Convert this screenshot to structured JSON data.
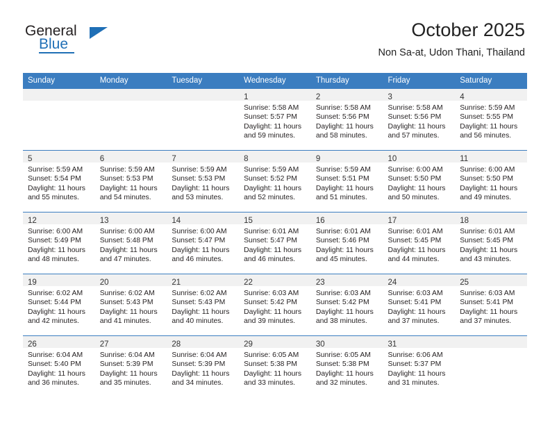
{
  "brand": {
    "name_top": "General",
    "name_bottom": "Blue",
    "accent_color": "#1f6fb6"
  },
  "header": {
    "title": "October 2025",
    "subtitle": "Non Sa-at, Udon Thani, Thailand"
  },
  "calendar": {
    "header_bg": "#3b7dc0",
    "header_text_color": "#ffffff",
    "daynum_band_bg": "#f1f1f1",
    "weekday_headers": [
      "Sunday",
      "Monday",
      "Tuesday",
      "Wednesday",
      "Thursday",
      "Friday",
      "Saturday"
    ],
    "weeks": [
      [
        {
          "empty": true
        },
        {
          "empty": true
        },
        {
          "empty": true
        },
        {
          "day": "1",
          "sunrise": "Sunrise: 5:58 AM",
          "sunset": "Sunset: 5:57 PM",
          "daylight_line1": "Daylight: 11 hours",
          "daylight_line2": "and 59 minutes."
        },
        {
          "day": "2",
          "sunrise": "Sunrise: 5:58 AM",
          "sunset": "Sunset: 5:56 PM",
          "daylight_line1": "Daylight: 11 hours",
          "daylight_line2": "and 58 minutes."
        },
        {
          "day": "3",
          "sunrise": "Sunrise: 5:58 AM",
          "sunset": "Sunset: 5:56 PM",
          "daylight_line1": "Daylight: 11 hours",
          "daylight_line2": "and 57 minutes."
        },
        {
          "day": "4",
          "sunrise": "Sunrise: 5:59 AM",
          "sunset": "Sunset: 5:55 PM",
          "daylight_line1": "Daylight: 11 hours",
          "daylight_line2": "and 56 minutes."
        }
      ],
      [
        {
          "day": "5",
          "sunrise": "Sunrise: 5:59 AM",
          "sunset": "Sunset: 5:54 PM",
          "daylight_line1": "Daylight: 11 hours",
          "daylight_line2": "and 55 minutes."
        },
        {
          "day": "6",
          "sunrise": "Sunrise: 5:59 AM",
          "sunset": "Sunset: 5:53 PM",
          "daylight_line1": "Daylight: 11 hours",
          "daylight_line2": "and 54 minutes."
        },
        {
          "day": "7",
          "sunrise": "Sunrise: 5:59 AM",
          "sunset": "Sunset: 5:53 PM",
          "daylight_line1": "Daylight: 11 hours",
          "daylight_line2": "and 53 minutes."
        },
        {
          "day": "8",
          "sunrise": "Sunrise: 5:59 AM",
          "sunset": "Sunset: 5:52 PM",
          "daylight_line1": "Daylight: 11 hours",
          "daylight_line2": "and 52 minutes."
        },
        {
          "day": "9",
          "sunrise": "Sunrise: 5:59 AM",
          "sunset": "Sunset: 5:51 PM",
          "daylight_line1": "Daylight: 11 hours",
          "daylight_line2": "and 51 minutes."
        },
        {
          "day": "10",
          "sunrise": "Sunrise: 6:00 AM",
          "sunset": "Sunset: 5:50 PM",
          "daylight_line1": "Daylight: 11 hours",
          "daylight_line2": "and 50 minutes."
        },
        {
          "day": "11",
          "sunrise": "Sunrise: 6:00 AM",
          "sunset": "Sunset: 5:50 PM",
          "daylight_line1": "Daylight: 11 hours",
          "daylight_line2": "and 49 minutes."
        }
      ],
      [
        {
          "day": "12",
          "sunrise": "Sunrise: 6:00 AM",
          "sunset": "Sunset: 5:49 PM",
          "daylight_line1": "Daylight: 11 hours",
          "daylight_line2": "and 48 minutes."
        },
        {
          "day": "13",
          "sunrise": "Sunrise: 6:00 AM",
          "sunset": "Sunset: 5:48 PM",
          "daylight_line1": "Daylight: 11 hours",
          "daylight_line2": "and 47 minutes."
        },
        {
          "day": "14",
          "sunrise": "Sunrise: 6:00 AM",
          "sunset": "Sunset: 5:47 PM",
          "daylight_line1": "Daylight: 11 hours",
          "daylight_line2": "and 46 minutes."
        },
        {
          "day": "15",
          "sunrise": "Sunrise: 6:01 AM",
          "sunset": "Sunset: 5:47 PM",
          "daylight_line1": "Daylight: 11 hours",
          "daylight_line2": "and 46 minutes."
        },
        {
          "day": "16",
          "sunrise": "Sunrise: 6:01 AM",
          "sunset": "Sunset: 5:46 PM",
          "daylight_line1": "Daylight: 11 hours",
          "daylight_line2": "and 45 minutes."
        },
        {
          "day": "17",
          "sunrise": "Sunrise: 6:01 AM",
          "sunset": "Sunset: 5:45 PM",
          "daylight_line1": "Daylight: 11 hours",
          "daylight_line2": "and 44 minutes."
        },
        {
          "day": "18",
          "sunrise": "Sunrise: 6:01 AM",
          "sunset": "Sunset: 5:45 PM",
          "daylight_line1": "Daylight: 11 hours",
          "daylight_line2": "and 43 minutes."
        }
      ],
      [
        {
          "day": "19",
          "sunrise": "Sunrise: 6:02 AM",
          "sunset": "Sunset: 5:44 PM",
          "daylight_line1": "Daylight: 11 hours",
          "daylight_line2": "and 42 minutes."
        },
        {
          "day": "20",
          "sunrise": "Sunrise: 6:02 AM",
          "sunset": "Sunset: 5:43 PM",
          "daylight_line1": "Daylight: 11 hours",
          "daylight_line2": "and 41 minutes."
        },
        {
          "day": "21",
          "sunrise": "Sunrise: 6:02 AM",
          "sunset": "Sunset: 5:43 PM",
          "daylight_line1": "Daylight: 11 hours",
          "daylight_line2": "and 40 minutes."
        },
        {
          "day": "22",
          "sunrise": "Sunrise: 6:03 AM",
          "sunset": "Sunset: 5:42 PM",
          "daylight_line1": "Daylight: 11 hours",
          "daylight_line2": "and 39 minutes."
        },
        {
          "day": "23",
          "sunrise": "Sunrise: 6:03 AM",
          "sunset": "Sunset: 5:42 PM",
          "daylight_line1": "Daylight: 11 hours",
          "daylight_line2": "and 38 minutes."
        },
        {
          "day": "24",
          "sunrise": "Sunrise: 6:03 AM",
          "sunset": "Sunset: 5:41 PM",
          "daylight_line1": "Daylight: 11 hours",
          "daylight_line2": "and 37 minutes."
        },
        {
          "day": "25",
          "sunrise": "Sunrise: 6:03 AM",
          "sunset": "Sunset: 5:41 PM",
          "daylight_line1": "Daylight: 11 hours",
          "daylight_line2": "and 37 minutes."
        }
      ],
      [
        {
          "day": "26",
          "sunrise": "Sunrise: 6:04 AM",
          "sunset": "Sunset: 5:40 PM",
          "daylight_line1": "Daylight: 11 hours",
          "daylight_line2": "and 36 minutes."
        },
        {
          "day": "27",
          "sunrise": "Sunrise: 6:04 AM",
          "sunset": "Sunset: 5:39 PM",
          "daylight_line1": "Daylight: 11 hours",
          "daylight_line2": "and 35 minutes."
        },
        {
          "day": "28",
          "sunrise": "Sunrise: 6:04 AM",
          "sunset": "Sunset: 5:39 PM",
          "daylight_line1": "Daylight: 11 hours",
          "daylight_line2": "and 34 minutes."
        },
        {
          "day": "29",
          "sunrise": "Sunrise: 6:05 AM",
          "sunset": "Sunset: 5:38 PM",
          "daylight_line1": "Daylight: 11 hours",
          "daylight_line2": "and 33 minutes."
        },
        {
          "day": "30",
          "sunrise": "Sunrise: 6:05 AM",
          "sunset": "Sunset: 5:38 PM",
          "daylight_line1": "Daylight: 11 hours",
          "daylight_line2": "and 32 minutes."
        },
        {
          "day": "31",
          "sunrise": "Sunrise: 6:06 AM",
          "sunset": "Sunset: 5:37 PM",
          "daylight_line1": "Daylight: 11 hours",
          "daylight_line2": "and 31 minutes."
        },
        {
          "empty": true
        }
      ]
    ]
  }
}
